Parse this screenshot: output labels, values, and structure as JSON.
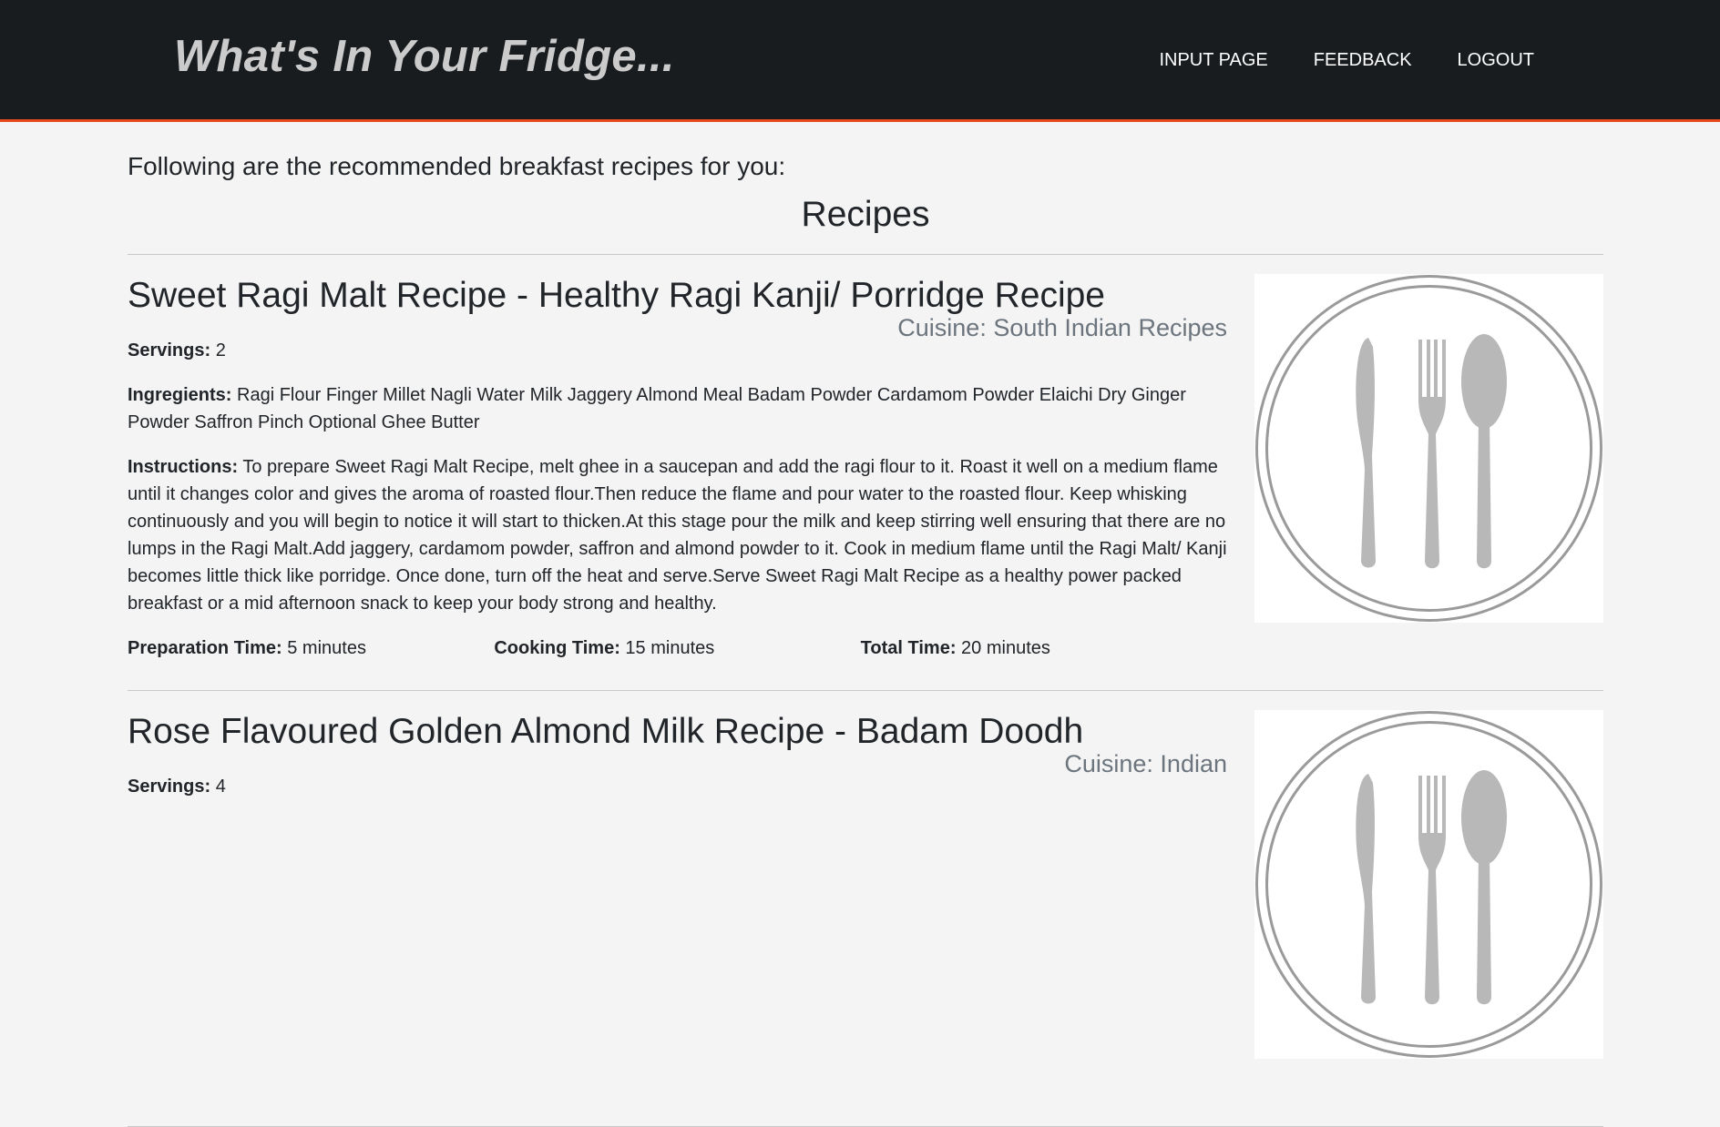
{
  "header": {
    "brand": "What's In Your Fridge...",
    "nav": [
      {
        "label": "INPUT PAGE"
      },
      {
        "label": "FEEDBACK"
      },
      {
        "label": "LOGOUT"
      }
    ]
  },
  "main": {
    "intro": "Following are the recommended breakfast recipes for you:",
    "section_title": "Recipes",
    "recipes": [
      {
        "name": "Sweet Ragi Malt Recipe - Healthy Ragi Kanji/ Porridge Recipe",
        "cuisine": "Cuisine: South Indian Recipes",
        "servings_label": "Servings:",
        "servings": "2",
        "ingredients_label": "Ingregients:",
        "ingredients": "Ragi Flour Finger Millet Nagli Water Milk Jaggery Almond Meal Badam Powder Cardamom Powder Elaichi Dry Ginger Powder Saffron Pinch Optional Ghee Butter",
        "instructions_label": "Instructions:",
        "instructions": "To prepare Sweet Ragi Malt Recipe, melt ghee in a saucepan and add the ragi flour to it. Roast it well on a medium flame until it changes color and gives the aroma of roasted flour.Then reduce the flame and pour water to the roasted flour. Keep whisking continuously and you will begin to notice it will start to thicken.At this stage pour the milk and keep stirring well ensuring that there are no lumps in the Ragi Malt.Add jaggery, cardamom powder, saffron and almond powder to it. Cook in medium flame until the Ragi Malt/ Kanji becomes little thick like porridge. Once done, turn off the heat and serve.Serve Sweet Ragi Malt Recipe as a healthy power packed breakfast or a mid afternoon snack to keep your body strong and healthy.",
        "prep_label": "Preparation Time:",
        "prep_time": "5 minutes",
        "cook_label": "Cooking Time:",
        "cook_time": "15 minutes",
        "total_label": "Total Time:",
        "total_time": "20 minutes",
        "image_icon": "plate-cutlery-icon"
      },
      {
        "name": "Rose Flavoured Golden Almond Milk Recipe - Badam Doodh",
        "cuisine": "Cuisine: Indian",
        "servings_label": "Servings:",
        "servings": "4",
        "image_icon": "plate-cutlery-icon"
      }
    ]
  },
  "colors": {
    "navbar_bg": "#181c1f",
    "accent": "#e8491d",
    "brand_text": "#cbcbcb",
    "page_bg": "#f4f4f4",
    "cuisine_text": "#6c757d"
  }
}
